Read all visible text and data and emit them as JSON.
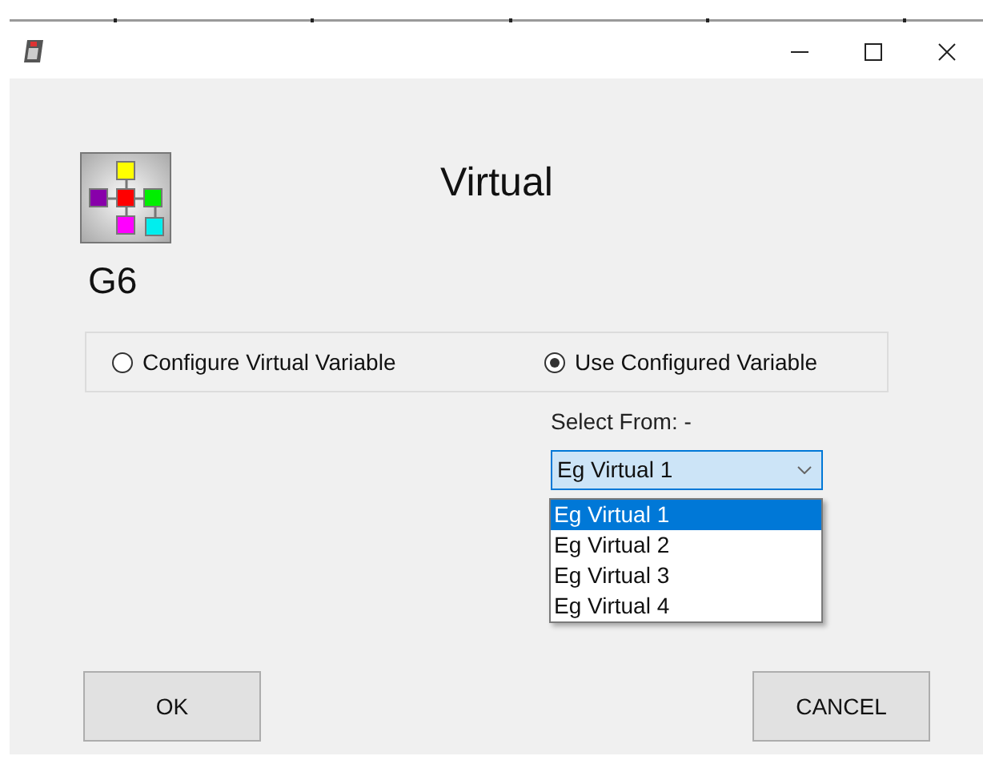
{
  "header": {
    "title": "Virtual",
    "device": "G6"
  },
  "mode": {
    "options": [
      {
        "label": "Configure Virtual Variable",
        "selected": false
      },
      {
        "label": "Use Configured Variable",
        "selected": true
      }
    ]
  },
  "select": {
    "label": "Select From: -",
    "value": "Eg Virtual 1",
    "expanded": true,
    "options": [
      {
        "label": "Eg Virtual 1",
        "selected": true
      },
      {
        "label": "Eg Virtual 2",
        "selected": false
      },
      {
        "label": "Eg Virtual 3",
        "selected": false
      },
      {
        "label": "Eg Virtual 4",
        "selected": false
      }
    ]
  },
  "buttons": [
    "OK",
    "CANCEL"
  ]
}
